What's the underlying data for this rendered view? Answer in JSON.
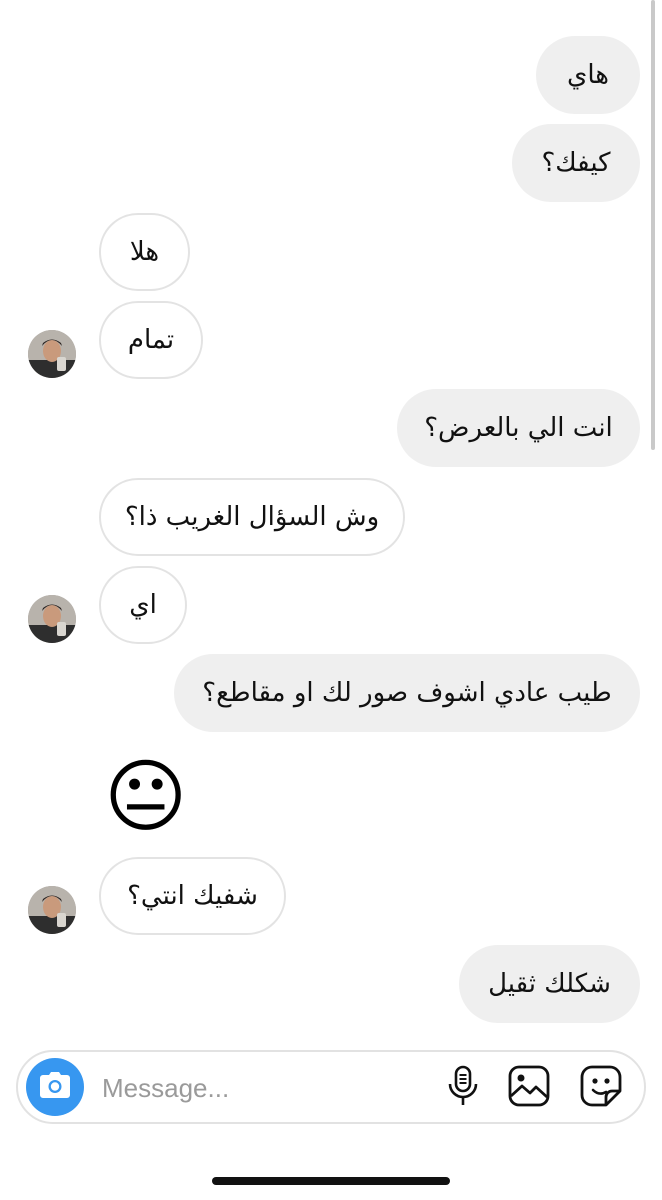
{
  "conversation": {
    "messages": [
      {
        "sender": "me",
        "text": "هاي"
      },
      {
        "sender": "me",
        "text": "كيفك؟"
      },
      {
        "sender": "them",
        "text": "هلا"
      },
      {
        "sender": "them",
        "text": "تمام"
      },
      {
        "sender": "me",
        "text": "انت الي بالعرض؟"
      },
      {
        "sender": "them",
        "text": "وش السؤال الغريب ذا؟"
      },
      {
        "sender": "them",
        "text": "اي"
      },
      {
        "sender": "me",
        "text": "طيب عادي اشوف صور لك او مقاطع؟"
      },
      {
        "sender": "them",
        "text": "😐"
      },
      {
        "sender": "them",
        "text": "شفيك انتي؟"
      },
      {
        "sender": "me",
        "text": "شكلك ثقيل"
      }
    ]
  },
  "composer": {
    "placeholder": "Message...",
    "icons": [
      "camera-icon",
      "microphone-icon",
      "gallery-icon",
      "sticker-icon"
    ]
  },
  "colors": {
    "sent_bubble": "#efefef",
    "received_border": "#e3e3e3",
    "camera_button": "#3797f0"
  }
}
